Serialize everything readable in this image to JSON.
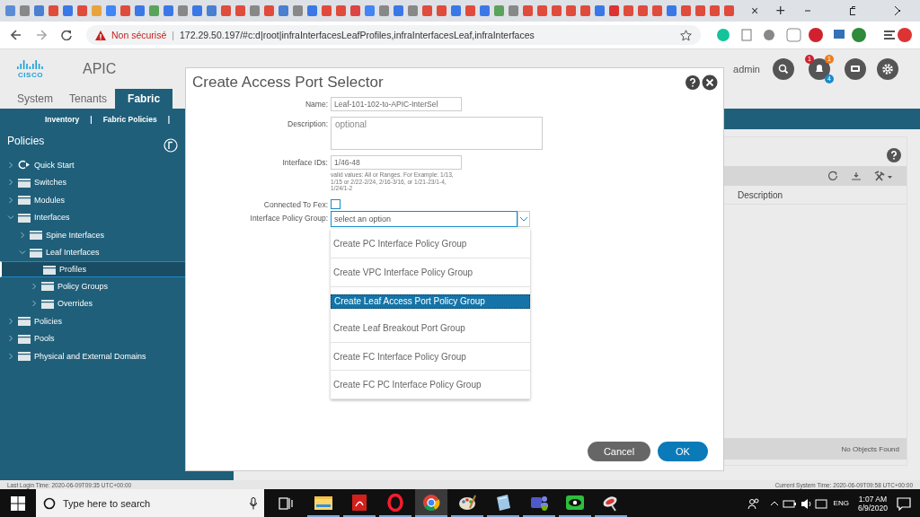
{
  "browser": {
    "tab_close": "×",
    "new_tab": "+",
    "security": "Non sécurisé",
    "separator": "|",
    "url": "172.29.50.197/#c:d|root|infraInterfacesLeafProfiles,infraInterfacesLeaf,infraInterfaces"
  },
  "header": {
    "logo": "CISCO",
    "app": "APIC",
    "user": "admin",
    "alerts": [
      {
        "count": "1",
        "color": "#d0222e"
      },
      {
        "count": "1",
        "color": "#f07c1b"
      },
      {
        "count": "4",
        "color": "#1a8acb"
      }
    ]
  },
  "tabs": [
    {
      "label": "System",
      "selected": false
    },
    {
      "label": "Tenants",
      "selected": false
    },
    {
      "label": "Fabric",
      "selected": true
    }
  ],
  "subnav": {
    "items": [
      "Inventory",
      "Fabric Policies"
    ],
    "separator": "|"
  },
  "sidebar": {
    "title": "Policies",
    "tree": [
      {
        "label": "Quick Start",
        "kind": "quickstart",
        "expanded": false,
        "selected": false
      },
      {
        "label": "Switches",
        "kind": "folder",
        "expanded": false,
        "selected": false
      },
      {
        "label": "Modules",
        "kind": "folder",
        "expanded": false,
        "selected": false
      },
      {
        "label": "Interfaces",
        "kind": "folder",
        "expanded": true,
        "selected": false,
        "children": [
          {
            "label": "Spine Interfaces",
            "kind": "folder",
            "expanded": false,
            "selected": false
          },
          {
            "label": "Leaf Interfaces",
            "kind": "folder",
            "expanded": true,
            "selected": false,
            "children": [
              {
                "label": "Profiles",
                "kind": "folder",
                "selected": true
              },
              {
                "label": "Policy Groups",
                "kind": "folder",
                "expanded": false,
                "selected": false
              },
              {
                "label": "Overrides",
                "kind": "folder",
                "expanded": false,
                "selected": false
              }
            ]
          }
        ]
      },
      {
        "label": "Policies",
        "kind": "folder",
        "expanded": false,
        "selected": false
      },
      {
        "label": "Pools",
        "kind": "folder",
        "expanded": false,
        "selected": false
      },
      {
        "label": "Physical and External Domains",
        "kind": "folder",
        "expanded": false,
        "selected": false
      }
    ]
  },
  "table": {
    "columns": [
      "Description"
    ],
    "empty": "No Objects Found"
  },
  "dialog": {
    "title": "Create Access Port Selector",
    "fields": [
      {
        "kind": "text",
        "label": "Name:",
        "value": "Leaf-101-102-to-APIC-InterSel"
      },
      {
        "kind": "textarea",
        "label": "Description:",
        "placeholder": "optional"
      },
      {
        "kind": "text",
        "label": "Interface IDs:",
        "value": "1/46-48",
        "hint": "valid values: All or Ranges. For Example: 1/13, 1/15 or 2/22-2/24, 2/16-3/16, or 1/21-23/1-4, 1/24/1-2"
      },
      {
        "kind": "checkbox",
        "label": "Connected To Fex:",
        "checked": false
      },
      {
        "kind": "select",
        "label": "Interface Policy Group:",
        "placeholder": "select an option",
        "expanded": true,
        "options": [
          {
            "label": "Create PC Interface Policy Group",
            "selected": false
          },
          {
            "label": "Create VPC Interface Policy Group",
            "selected": false
          },
          {
            "label": "Create Leaf Access Port Policy Group",
            "selected": true
          },
          {
            "label": "Create Leaf Breakout Port Group",
            "selected": false
          },
          {
            "label": "Create FC Interface Policy Group",
            "selected": false
          },
          {
            "label": "Create FC PC Interface Policy Group",
            "selected": false
          }
        ]
      }
    ],
    "buttons": [
      {
        "label": "Cancel",
        "kind": "secondary"
      },
      {
        "label": "OK",
        "kind": "primary"
      }
    ]
  },
  "status_bar": {
    "last_login": "Last Login Time: 2020-06-09T09:35 UTC+00:00",
    "system_time": "Current System Time: 2020-06-09T09:58 UTC+00:00"
  },
  "taskbar": {
    "search_placeholder": "Type here to search",
    "apps": [
      {
        "kind": "folder",
        "selected": false
      },
      {
        "kind": "pdf",
        "selected": false
      },
      {
        "kind": "opera",
        "selected": false
      },
      {
        "kind": "chrome",
        "selected": true
      },
      {
        "kind": "paint",
        "selected": false
      },
      {
        "kind": "notes",
        "selected": false
      },
      {
        "kind": "teams",
        "selected": false
      },
      {
        "kind": "eye",
        "selected": false
      },
      {
        "kind": "satellite",
        "selected": false
      }
    ],
    "language": "ENG",
    "time": "1:07 AM",
    "date": "6/9/2020"
  }
}
